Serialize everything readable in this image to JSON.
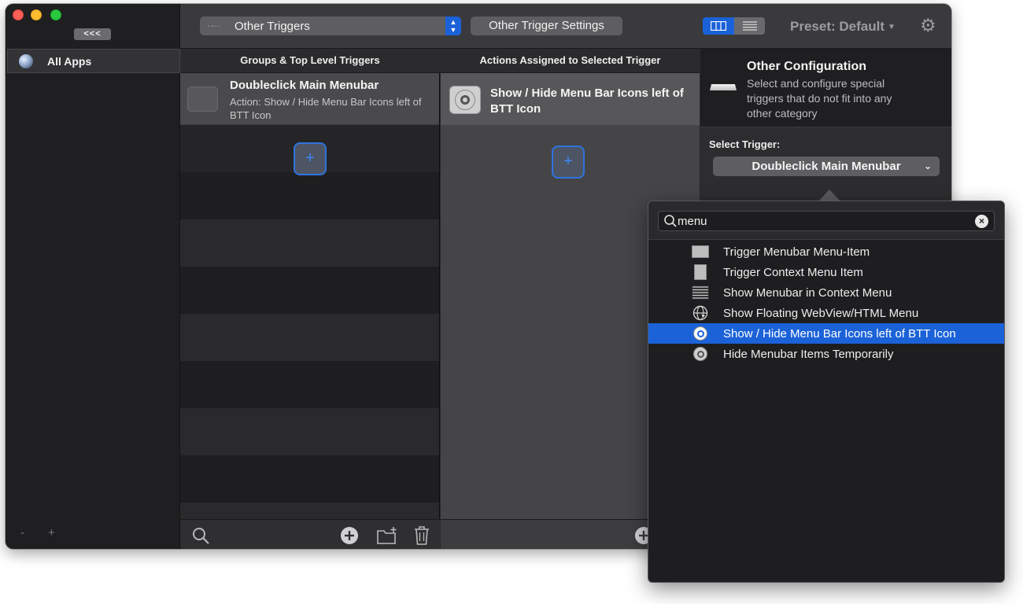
{
  "sidebar": {
    "collapse_label": "<<<",
    "app_label": "All Apps",
    "minus": "-",
    "plus": "+"
  },
  "toolbar": {
    "trigger_type": "Other Triggers",
    "trigger_dots": "·-··",
    "settings_label": "Other Trigger Settings",
    "preset_label": "Preset: Default"
  },
  "groups": {
    "header": "Groups & Top Level Triggers",
    "trigger": {
      "title": "Doubleclick Main Menubar",
      "subtitle": "Action: Show / Hide Menu Bar Icons left of BTT Icon"
    },
    "add_label": "+"
  },
  "actions": {
    "header": "Actions Assigned to Selected Trigger",
    "action": {
      "title": "Show / Hide Menu Bar Icons left of BTT Icon"
    },
    "add_label": "+"
  },
  "config": {
    "title": "Other Configuration",
    "description": "Select and configure special triggers that do not  fit into any other category",
    "select_label": "Select Trigger:",
    "selected_trigger": "Doubleclick Main Menubar"
  },
  "popover": {
    "search_value": "menu",
    "results": [
      {
        "label": "Trigger Menubar Menu-Item",
        "icon": "menubar-item-icon"
      },
      {
        "label": "Trigger Context Menu Item",
        "icon": "context-menu-icon"
      },
      {
        "label": "Show Menubar in Context Menu",
        "icon": "menu-lines-icon"
      },
      {
        "label": "Show Floating WebView/HTML Menu",
        "icon": "globe-cursor-icon"
      },
      {
        "label": "Show / Hide Menu Bar Icons left of BTT Icon",
        "icon": "target-icon",
        "selected": true
      },
      {
        "label": "Hide Menubar Items Temporarily",
        "icon": "target-icon"
      }
    ]
  },
  "colors": {
    "accent": "#1b62d8",
    "window_bg": "#2a2a2c",
    "sidebar_bg": "#1f1f21"
  }
}
